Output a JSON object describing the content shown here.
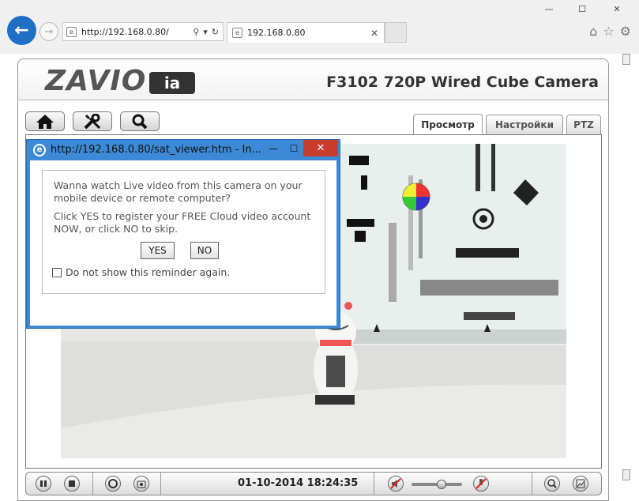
{
  "browser": {
    "address": "http://192.168.0.80/",
    "tab_title": "192.168.0.80",
    "tab_close": "✕"
  },
  "header": {
    "logo": "ZAVIO",
    "logo_badge": "ia",
    "title": "F3102 720P Wired Cube Camera"
  },
  "tabs": [
    {
      "label": "Просмотр",
      "active": true
    },
    {
      "label": "Настройки",
      "active": false
    },
    {
      "label": "PTZ",
      "active": false
    }
  ],
  "nav_icons": [
    "home-icon",
    "tools-icon",
    "search-icon"
  ],
  "controlbar": {
    "datetime": "01-10-2014 18:24:35"
  },
  "popup": {
    "title": "http://192.168.0.80/sat_viewer.htm - In...",
    "message1": "Wanna watch Live video from this camera on your mobile device or remote computer?",
    "message2": "Click YES to register your FREE Cloud video account NOW, or click NO to skip.",
    "yes_label": "YES",
    "no_label": "NO",
    "checkbox_label": "Do not show this reminder again."
  },
  "colors": {
    "browser_accent": "#1f6fc6",
    "popup_frame": "#3c8ad6",
    "popup_close": "#c83b2f"
  }
}
